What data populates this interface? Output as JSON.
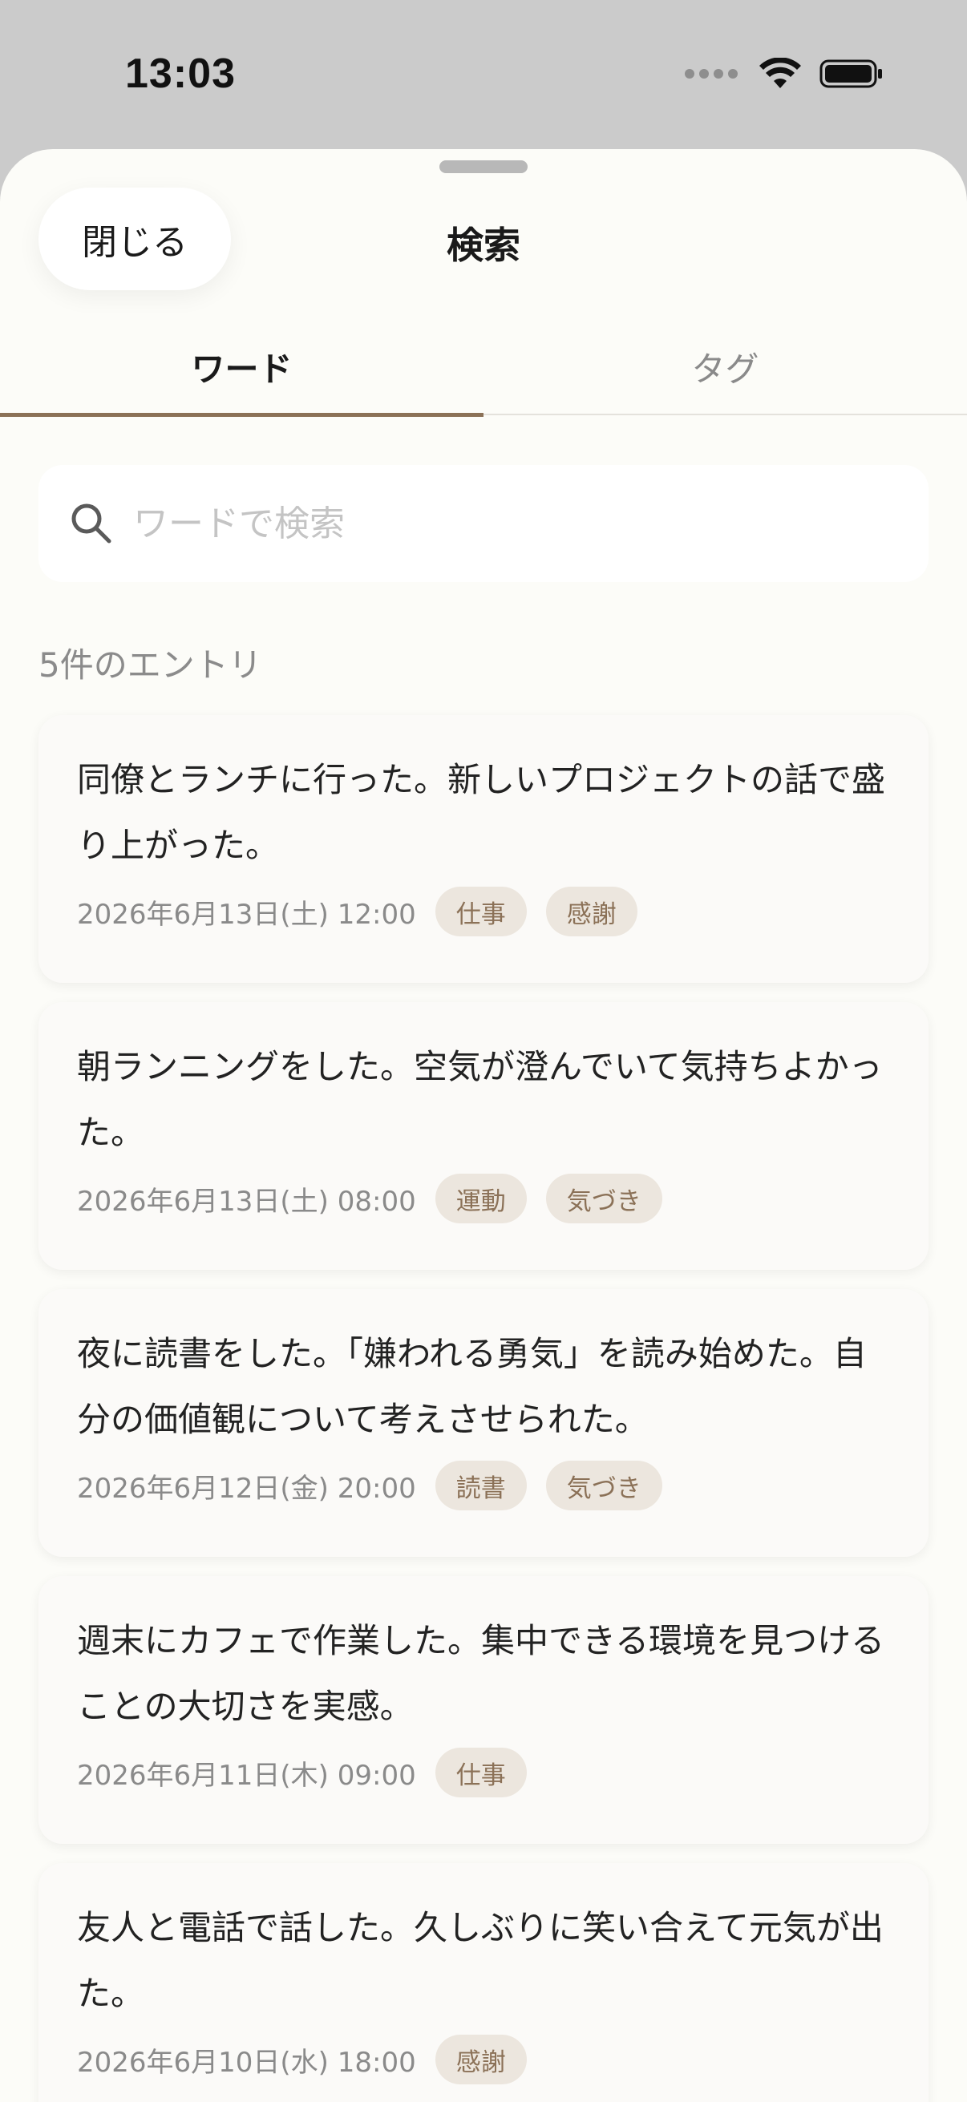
{
  "status_bar": {
    "time": "13:03"
  },
  "header": {
    "close_label": "閉じる",
    "title": "検索"
  },
  "tabs": [
    {
      "label": "ワード",
      "active": true
    },
    {
      "label": "タグ",
      "active": false
    }
  ],
  "search": {
    "placeholder": "ワードで検索",
    "value": ""
  },
  "results": {
    "count_label": "5件のエントリ"
  },
  "colors": {
    "accent": "#8b7157",
    "tag_bg": "#ece6de",
    "sheet_bg": "#fcfcf8"
  },
  "entries": [
    {
      "text": "同僚とランチに行った。新しいプロジェクトの話で盛り上がった。",
      "date": "2026年6月13日(土) 12:00",
      "tags": [
        "仕事",
        "感謝"
      ]
    },
    {
      "text": "朝ランニングをした。空気が澄んでいて気持ちよかった。",
      "date": "2026年6月13日(土) 08:00",
      "tags": [
        "運動",
        "気づき"
      ]
    },
    {
      "text": "夜に読書をした。「嫌われる勇気」を読み始めた。自分の価値観について考えさせられた。",
      "date": "2026年6月12日(金) 20:00",
      "tags": [
        "読書",
        "気づき"
      ]
    },
    {
      "text": "週末にカフェで作業した。集中できる環境を見つけることの大切さを実感。",
      "date": "2026年6月11日(木) 09:00",
      "tags": [
        "仕事"
      ]
    },
    {
      "text": "友人と電話で話した。久しぶりに笑い合えて元気が出た。",
      "date": "2026年6月10日(水) 18:00",
      "tags": [
        "感謝"
      ]
    }
  ]
}
